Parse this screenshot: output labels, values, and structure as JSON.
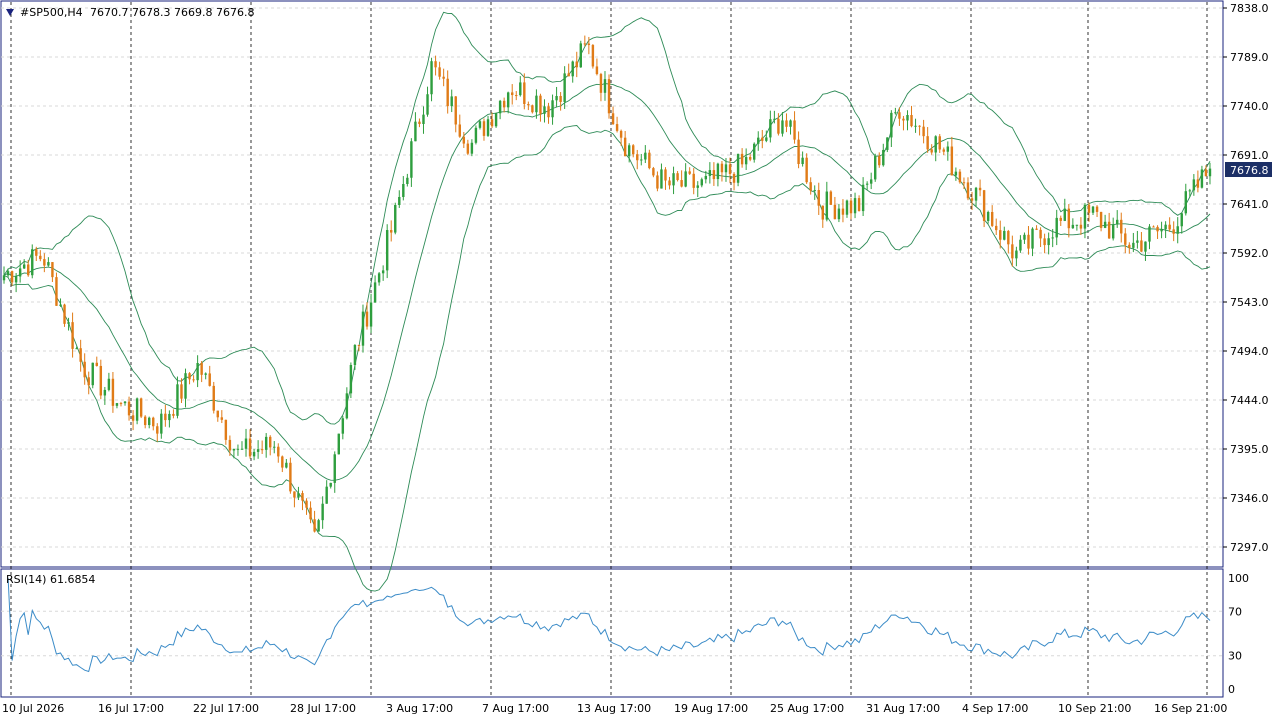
{
  "symbol_header": {
    "arrow_icon": "triangle-down-icon",
    "symbol": "#SP500,H4",
    "ohlc": "7670.7 7678.3 7669.8 7676.8"
  },
  "price_axis": {
    "labels": [
      "7838.0",
      "7789.0",
      "7740.0",
      "7691.0",
      "7641.0",
      "7592.0",
      "7543.0",
      "7494.0",
      "7444.0",
      "7395.0",
      "7346.0",
      "7297.0"
    ],
    "current_price_label": "7676.8"
  },
  "rsi_panel": {
    "label": "RSI(14) 61.6854",
    "levels": [
      "100",
      "70",
      "30",
      "0"
    ]
  },
  "time_axis": {
    "labels": [
      "10 Jul 2026",
      "16 Jul 17:00",
      "22 Jul 17:00",
      "28 Jul 17:00",
      "3 Aug 17:00",
      "7 Aug 17:00",
      "13 Aug 17:00",
      "19 Aug 17:00",
      "25 Aug 17:00",
      "31 Aug 17:00",
      "4 Sep 17:00",
      "10 Sep 21:00",
      "16 Sep 21:00"
    ]
  },
  "colors": {
    "bull": "#2e9e3e",
    "bear": "#e07b17",
    "bands": "#2e8b57",
    "rsi": "#3c8cc8",
    "price_tag_bg": "#1c2f66",
    "grid": "#d8d8d8",
    "border": "#1a237e"
  },
  "chart_data": {
    "type": "candlestick",
    "title": "#SP500,H4",
    "y_range": [
      7280,
      7845
    ],
    "rsi_range": [
      0,
      100
    ],
    "rsi_levels": [
      70,
      30
    ],
    "last_close": 7676.8,
    "indicators": [
      "Bollinger Bands",
      "RSI(14)"
    ],
    "x": [
      "10 Jul 2026",
      "16 Jul 17:00",
      "22 Jul 17:00",
      "28 Jul 17:00",
      "3 Aug 17:00",
      "7 Aug 17:00",
      "13 Aug 17:00",
      "19 Aug 17:00",
      "25 Aug 17:00",
      "31 Aug 17:00",
      "4 Sep 17:00",
      "10 Sep 21:00",
      "16 Sep 21:00"
    ],
    "close": [
      7570,
      7590,
      7480,
      7440,
      7420,
      7480,
      7390,
      7400,
      7300,
      7490,
      7620,
      7780,
      7700,
      7760,
      7740,
      7800,
      7700,
      7660,
      7660,
      7680,
      7730,
      7640,
      7640,
      7740,
      7700,
      7650,
      7590,
      7620,
      7630,
      7600,
      7620,
      7676.8
    ],
    "rsi_value": 61.6854
  }
}
